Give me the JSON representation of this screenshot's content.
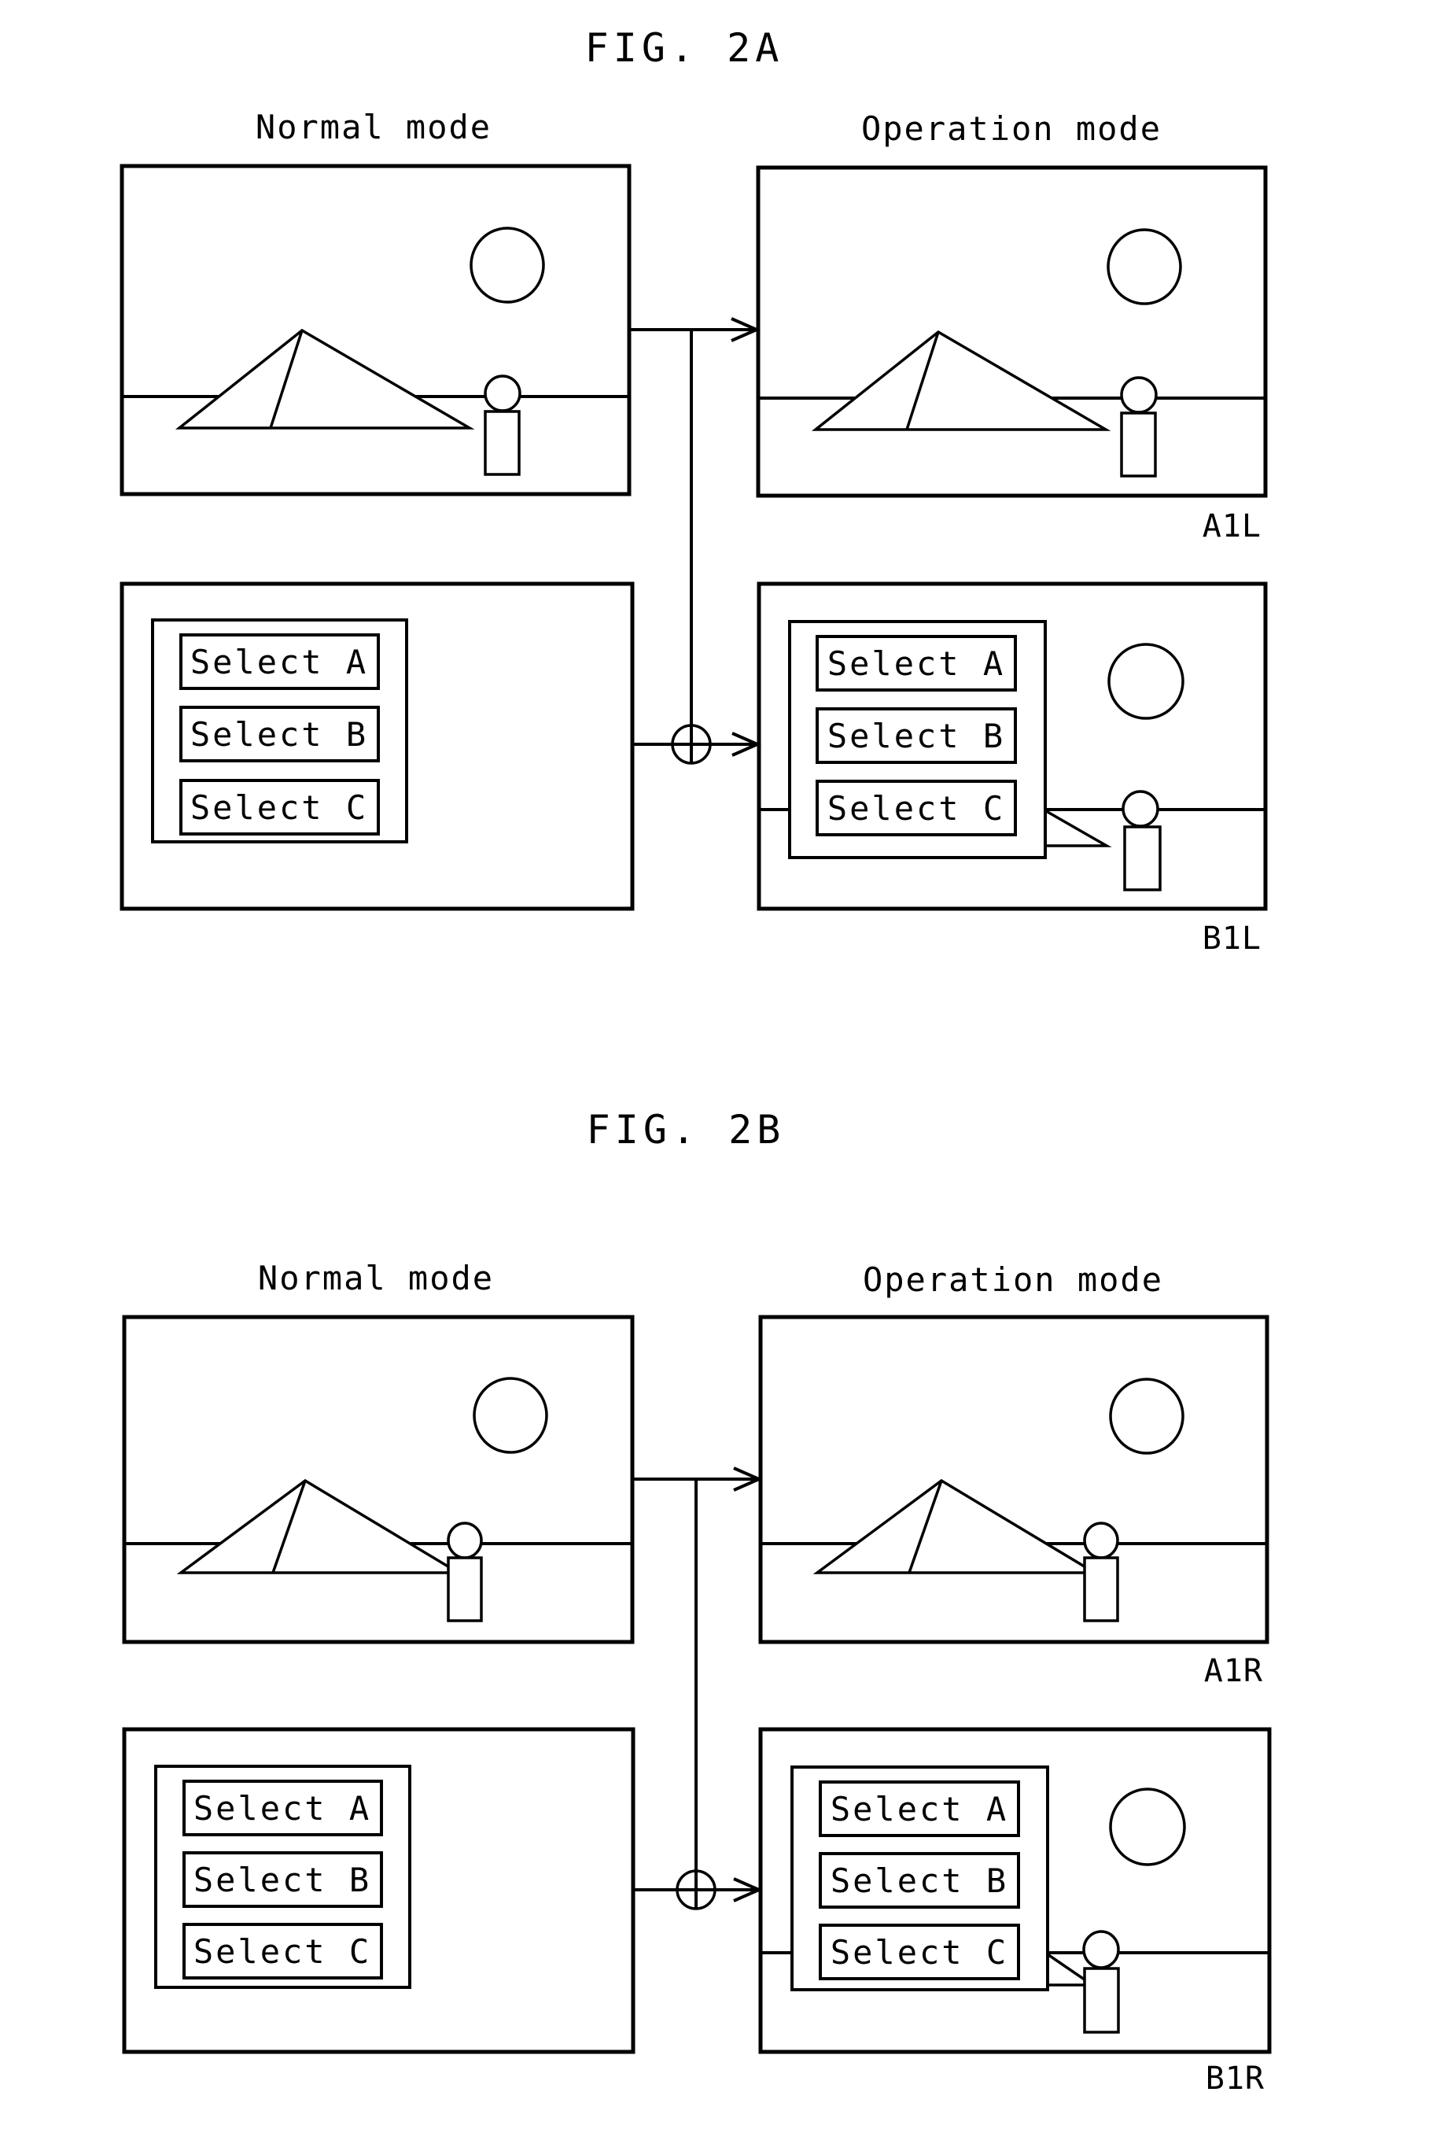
{
  "figures": [
    {
      "id": "2A",
      "title": "FIG. 2A",
      "left_heading": "Normal mode",
      "right_heading": "Operation mode",
      "panel_refs": {
        "top_right": "A1L",
        "bottom_right": "B1L"
      },
      "menu_items": [
        "Select A",
        "Select B",
        "Select C"
      ],
      "person_overlaps_mountain": false
    },
    {
      "id": "2B",
      "title": "FIG. 2B",
      "left_heading": "Normal mode",
      "right_heading": "Operation mode",
      "panel_refs": {
        "top_right": "A1R",
        "bottom_right": "B1R"
      },
      "menu_items": [
        "Select A",
        "Select B",
        "Select C"
      ],
      "person_overlaps_mountain": true
    }
  ],
  "icons": {
    "combiner": "circle-plus-icon",
    "arrow": "arrow-right-icon",
    "sun": "circle-sun-icon",
    "mountain": "triangle-mountain-icon",
    "person": "person-figure-icon"
  }
}
